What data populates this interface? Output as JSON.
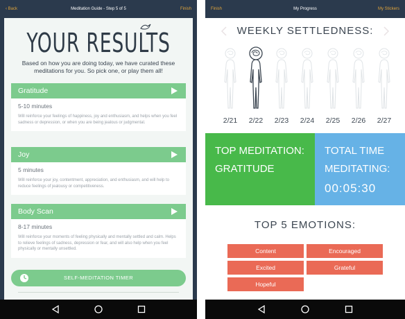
{
  "left_screen": {
    "topbar": {
      "back_label": "Back",
      "title": "Meditation Guide - Step 5 of 5",
      "finish_label": "Finish"
    },
    "results_title": "YOUR RESULTS",
    "intro": "Based on how you are doing today, we have curated these meditations for you. So pick one, or play them all!",
    "meditations": [
      {
        "name": "Gratitude",
        "duration": "5-10 minutes",
        "description": "Will reinforce your feelings of happiness, joy and enthusiasm, and helps when you feel sadness or depression, or when you are being jealous or judgmental."
      },
      {
        "name": "Joy",
        "duration": "5 minutes",
        "description": "Will reinforce your joy, contentment, appreciation, and enthusiasm, and will help to reduce feelings of jealousy or competitiveness."
      },
      {
        "name": "Body Scan",
        "duration": "8-17 minutes",
        "description": "Will reinforce your moments of feeling physically and mentally settled and calm. Helps to relieve feelings of sadness, depression or fear, and will also help when you feel physically or mentally unsettled."
      }
    ],
    "timer_button": "SELF-MEDITATION TIMER"
  },
  "right_screen": {
    "topbar": {
      "finish_label": "Finish",
      "title": "My Progress",
      "stickers_label": "My Stickers"
    },
    "weekly_title": "WEEKLY SETTLEDNESS:",
    "days": [
      "2/21",
      "2/22",
      "2/23",
      "2/24",
      "2/25",
      "2/26",
      "2/27"
    ],
    "active_day_index": 1,
    "top_meditation": {
      "line1": "TOP MEDITATION:",
      "line2": "GRATITUDE"
    },
    "total_time": {
      "line1": "TOTAL TIME",
      "line2": "MEDITATING:",
      "value": "00:05:30"
    },
    "emotions_title": "TOP 5 EMOTIONS:",
    "emotions": [
      "Content",
      "Encouraged",
      "Excited",
      "Grateful",
      "Hopeful"
    ]
  },
  "colors": {
    "header_bg": "#2b3a4d",
    "accent_orange": "#e2a53a",
    "green": "#7ccb8d",
    "tile_green": "#48b94a",
    "tile_blue": "#66b2e6",
    "emotion_red": "#ea6a56"
  },
  "icons": [
    "back-icon",
    "bird-icon",
    "play-icon",
    "timer-icon",
    "chevron-left-icon",
    "chevron-right-icon",
    "person-figure-icon",
    "nav-back-icon",
    "nav-home-icon",
    "nav-recent-icon"
  ]
}
